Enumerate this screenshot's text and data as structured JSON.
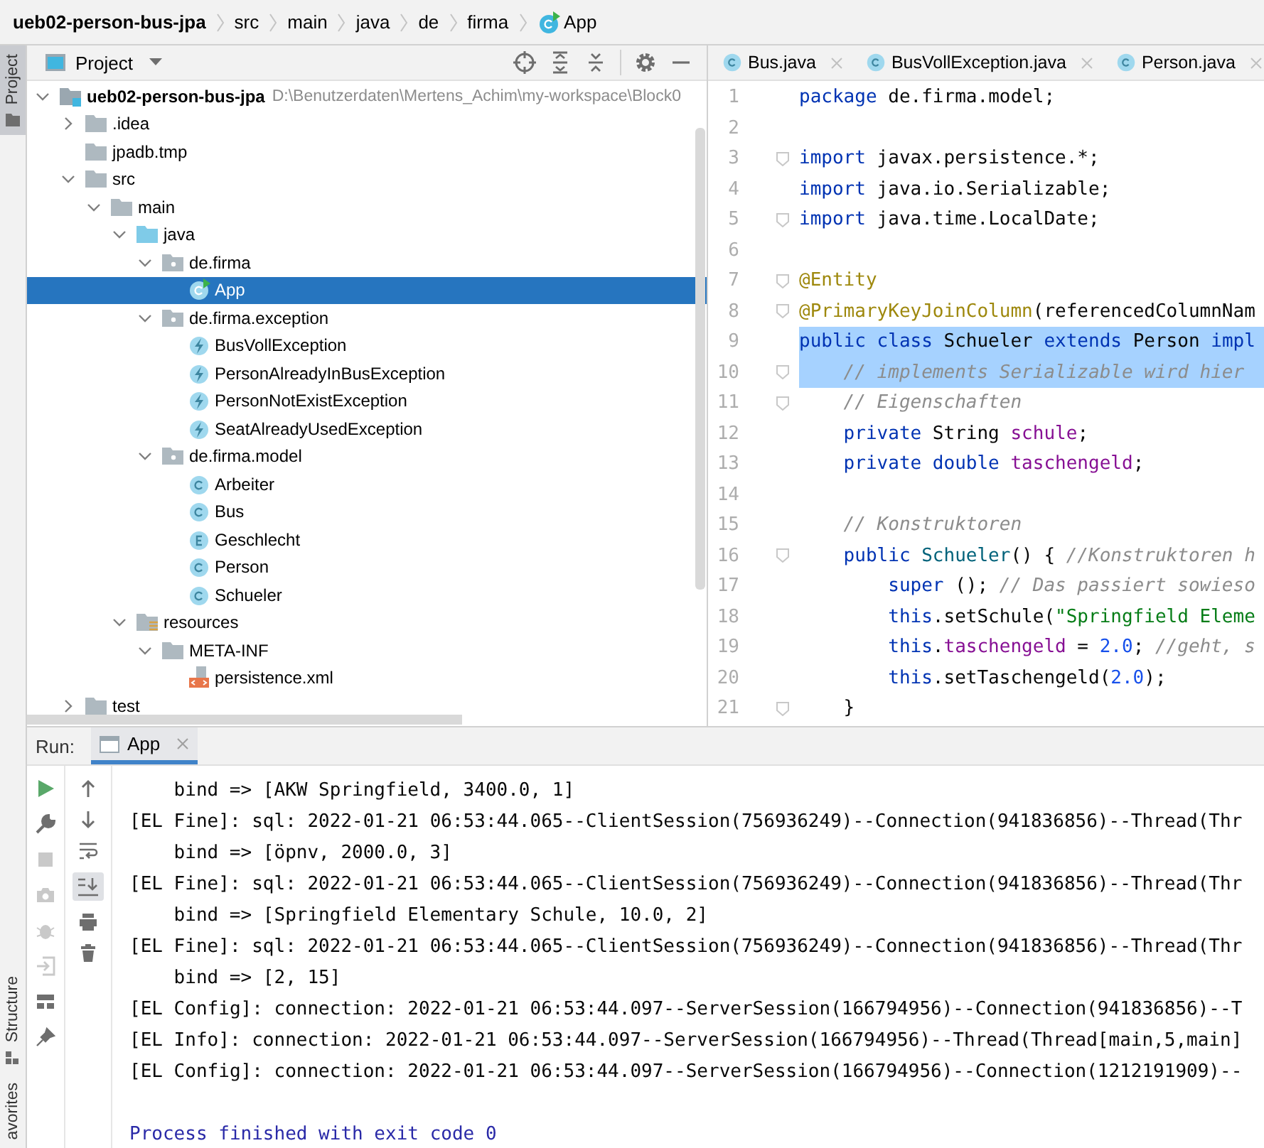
{
  "breadcrumbs": [
    {
      "kind": "project",
      "text": "ueb02-person-bus-jpa"
    },
    {
      "kind": "dir",
      "text": "src"
    },
    {
      "kind": "dir",
      "text": "main"
    },
    {
      "kind": "dir",
      "text": "java"
    },
    {
      "kind": "dir",
      "text": "de"
    },
    {
      "kind": "dir",
      "text": "firma"
    },
    {
      "kind": "class",
      "text": "App"
    }
  ],
  "side_tabs_top": [
    {
      "label": "Project",
      "selected": true
    }
  ],
  "side_tabs_bottom": [
    {
      "label": "Structure",
      "selected": false
    },
    {
      "label": "avorites",
      "selected": false
    }
  ],
  "project": {
    "title": "Project",
    "tree": [
      {
        "name": "ueb02-person-bus-jpa",
        "kind": "module",
        "path": "D:\\Benutzerdaten\\Mertens_Achim\\my-workspace\\Block0",
        "expanded": true,
        "selected": false,
        "children": [
          {
            "name": ".idea",
            "kind": "folder",
            "expanded": false,
            "selected": false
          },
          {
            "name": "jpadb.tmp",
            "kind": "folder",
            "selected": false
          },
          {
            "name": "src",
            "kind": "folder",
            "expanded": true,
            "selected": false,
            "children": [
              {
                "name": "main",
                "kind": "folder",
                "expanded": true,
                "selected": false,
                "children": [
                  {
                    "name": "java",
                    "kind": "source",
                    "expanded": true,
                    "selected": false,
                    "children": [
                      {
                        "name": "de.firma",
                        "kind": "package",
                        "expanded": true,
                        "selected": false,
                        "children": [
                          {
                            "name": "App",
                            "kind": "main",
                            "selected": true
                          }
                        ]
                      },
                      {
                        "name": "de.firma.exception",
                        "kind": "package",
                        "expanded": true,
                        "selected": false,
                        "children": [
                          {
                            "name": "BusVollException",
                            "kind": "exception",
                            "selected": false
                          },
                          {
                            "name": "PersonAlreadyInBusException",
                            "kind": "exception",
                            "selected": false
                          },
                          {
                            "name": "PersonNotExistException",
                            "kind": "exception",
                            "selected": false
                          },
                          {
                            "name": "SeatAlreadyUsedException",
                            "kind": "exception",
                            "selected": false
                          }
                        ]
                      },
                      {
                        "name": "de.firma.model",
                        "kind": "package",
                        "expanded": true,
                        "selected": false,
                        "children": [
                          {
                            "name": "Arbeiter",
                            "kind": "class",
                            "selected": false
                          },
                          {
                            "name": "Bus",
                            "kind": "class",
                            "selected": false
                          },
                          {
                            "name": "Geschlecht",
                            "kind": "enum",
                            "selected": false
                          },
                          {
                            "name": "Person",
                            "kind": "class",
                            "selected": false
                          },
                          {
                            "name": "Schueler",
                            "kind": "class",
                            "selected": false
                          }
                        ]
                      }
                    ]
                  },
                  {
                    "name": "resources",
                    "kind": "resources",
                    "expanded": true,
                    "selected": false,
                    "children": [
                      {
                        "name": "META-INF",
                        "kind": "folder",
                        "expanded": true,
                        "selected": false,
                        "children": [
                          {
                            "name": "persistence.xml",
                            "kind": "xml",
                            "selected": false
                          }
                        ]
                      }
                    ]
                  }
                ]
              }
            ]
          },
          {
            "name": "test",
            "kind": "folder",
            "expanded": false,
            "selected": false
          }
        ]
      }
    ]
  },
  "editor": {
    "tabs": [
      {
        "label": "Bus.java",
        "selected": false
      },
      {
        "label": "BusVollException.java",
        "selected": false
      },
      {
        "label": "Person.java",
        "selected": false
      }
    ],
    "lines": [
      {
        "n": "1",
        "fold": false,
        "selected": false,
        "tokens": [
          {
            "kind": "kw",
            "text": "package "
          },
          {
            "kind": "pl",
            "text": "de.firma.model;"
          }
        ]
      },
      {
        "n": "2",
        "fold": false,
        "selected": false
      },
      {
        "n": "3",
        "fold": true,
        "selected": false,
        "tokens": [
          {
            "kind": "kw",
            "text": "import "
          },
          {
            "kind": "pl",
            "text": "javax.persistence.*;"
          }
        ]
      },
      {
        "n": "4",
        "fold": false,
        "selected": false,
        "tokens": [
          {
            "kind": "kw",
            "text": "import "
          },
          {
            "kind": "pl",
            "text": "java.io.Serializable;"
          }
        ]
      },
      {
        "n": "5",
        "fold": true,
        "selected": false,
        "tokens": [
          {
            "kind": "kw",
            "text": "import "
          },
          {
            "kind": "pl",
            "text": "java.time.LocalDate;"
          }
        ]
      },
      {
        "n": "6",
        "fold": false,
        "selected": false
      },
      {
        "n": "7",
        "fold": true,
        "selected": false,
        "tokens": [
          {
            "kind": "ann",
            "text": "@Entity"
          }
        ]
      },
      {
        "n": "8",
        "fold": true,
        "selected": false,
        "tokens": [
          {
            "kind": "ann",
            "text": "@PrimaryKeyJoinColumn"
          },
          {
            "kind": "pl",
            "text": "(referencedColumnNam"
          }
        ]
      },
      {
        "n": "9",
        "fold": false,
        "selected": true,
        "tokens": [
          {
            "kind": "kw",
            "text": "public class "
          },
          {
            "kind": "pl",
            "text": "Schueler "
          },
          {
            "kind": "kw",
            "text": "extends "
          },
          {
            "kind": "pl",
            "text": "Person "
          },
          {
            "kind": "kw",
            "text": "impl"
          }
        ]
      },
      {
        "n": "10",
        "fold": true,
        "selected": true,
        "tokens": [
          {
            "kind": "com",
            "text": "    // implements Serializable wird hier"
          }
        ]
      },
      {
        "n": "11",
        "fold": true,
        "selected": false,
        "tokens": [
          {
            "kind": "com",
            "text": "    // Eigenschaften"
          }
        ]
      },
      {
        "n": "12",
        "fold": false,
        "selected": false,
        "tokens": [
          {
            "kind": "kw",
            "text": "    private "
          },
          {
            "kind": "pl",
            "text": "String "
          },
          {
            "kind": "fld",
            "text": "schule"
          },
          {
            "kind": "pl",
            "text": ";"
          }
        ]
      },
      {
        "n": "13",
        "fold": false,
        "selected": false,
        "tokens": [
          {
            "kind": "kw",
            "text": "    private double "
          },
          {
            "kind": "fld",
            "text": "taschengeld"
          },
          {
            "kind": "pl",
            "text": ";"
          }
        ]
      },
      {
        "n": "14",
        "fold": false,
        "selected": false
      },
      {
        "n": "15",
        "fold": false,
        "selected": false,
        "tokens": [
          {
            "kind": "com",
            "text": "    // Konstruktoren"
          }
        ]
      },
      {
        "n": "16",
        "fold": true,
        "selected": false,
        "tokens": [
          {
            "kind": "kw",
            "text": "    public "
          },
          {
            "kind": "fn",
            "text": "Schueler"
          },
          {
            "kind": "pl",
            "text": "() { "
          },
          {
            "kind": "com",
            "text": "//Konstruktoren h"
          }
        ]
      },
      {
        "n": "17",
        "fold": false,
        "selected": false,
        "tokens": [
          {
            "kind": "kw",
            "text": "        super "
          },
          {
            "kind": "pl",
            "text": "(); "
          },
          {
            "kind": "com",
            "text": "// Das passiert sowieso"
          }
        ]
      },
      {
        "n": "18",
        "fold": false,
        "selected": false,
        "tokens": [
          {
            "kind": "kw",
            "text": "        this"
          },
          {
            "kind": "pl",
            "text": ".setSchule("
          },
          {
            "kind": "str",
            "text": "\"Springfield Eleme"
          }
        ]
      },
      {
        "n": "19",
        "fold": false,
        "selected": false,
        "tokens": [
          {
            "kind": "kw",
            "text": "        this"
          },
          {
            "kind": "pl",
            "text": "."
          },
          {
            "kind": "fld",
            "text": "taschengeld"
          },
          {
            "kind": "pl",
            "text": " = "
          },
          {
            "kind": "num",
            "text": "2.0"
          },
          {
            "kind": "pl",
            "text": "; "
          },
          {
            "kind": "com",
            "text": "//geht, s"
          }
        ]
      },
      {
        "n": "20",
        "fold": false,
        "selected": false,
        "tokens": [
          {
            "kind": "kw",
            "text": "        this"
          },
          {
            "kind": "pl",
            "text": ".setTaschengeld("
          },
          {
            "kind": "num",
            "text": "2.0"
          },
          {
            "kind": "pl",
            "text": ");"
          }
        ]
      },
      {
        "n": "21",
        "fold": true,
        "selected": false,
        "tokens": [
          {
            "kind": "pl",
            "text": "    }"
          }
        ]
      }
    ]
  },
  "run": {
    "label": "Run:",
    "tabs": [
      {
        "label": "App",
        "selected": true
      }
    ],
    "console": [
      {
        "kind": "bind",
        "text": "bind => [AKW Springfield, 3400.0, 1]"
      },
      {
        "kind": "log",
        "text": "[EL Fine]: sql: 2022-01-21 06:53:44.065--ClientSession(756936249)--Connection(941836856)--Thread(Thr"
      },
      {
        "kind": "bind",
        "text": "bind => [öpnv, 2000.0, 3]"
      },
      {
        "kind": "log",
        "text": "[EL Fine]: sql: 2022-01-21 06:53:44.065--ClientSession(756936249)--Connection(941836856)--Thread(Thr"
      },
      {
        "kind": "bind",
        "text": "bind => [Springfield Elementary Schule, 10.0, 2]"
      },
      {
        "kind": "log",
        "text": "[EL Fine]: sql: 2022-01-21 06:53:44.065--ClientSession(756936249)--Connection(941836856)--Thread(Thr"
      },
      {
        "kind": "bind",
        "text": "bind => [2, 15]"
      },
      {
        "kind": "log",
        "text": "[EL Config]: connection: 2022-01-21 06:53:44.097--ServerSession(166794956)--Connection(941836856)--T"
      },
      {
        "kind": "log",
        "text": "[EL Info]: connection: 2022-01-21 06:53:44.097--ServerSession(166794956)--Thread(Thread[main,5,main]"
      },
      {
        "kind": "log",
        "text": "[EL Config]: connection: 2022-01-21 06:53:44.097--ServerSession(166794956)--Connection(1212191909)--"
      },
      {
        "kind": "exit",
        "text": "Process finished with exit code 0"
      }
    ]
  }
}
